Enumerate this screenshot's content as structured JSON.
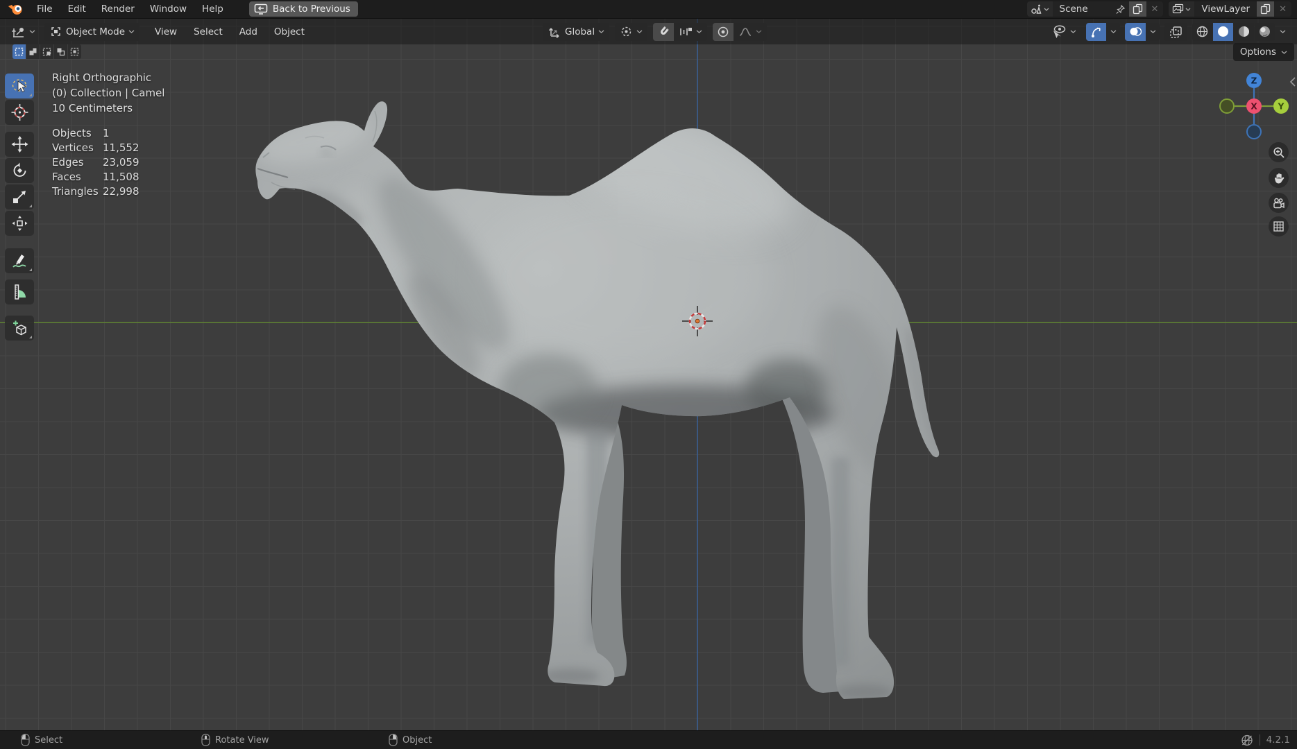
{
  "topbar": {
    "menus": [
      {
        "label": "File"
      },
      {
        "label": "Edit"
      },
      {
        "label": "Render"
      },
      {
        "label": "Window"
      },
      {
        "label": "Help"
      }
    ],
    "back_button": {
      "label": "Back to Previous"
    },
    "scene_selector": {
      "value": "Scene"
    },
    "viewlayer_selector": {
      "value": "ViewLayer"
    }
  },
  "viewport_header": {
    "mode_selector": {
      "value": "Object Mode"
    },
    "menus": [
      {
        "label": "View"
      },
      {
        "label": "Select"
      },
      {
        "label": "Add"
      },
      {
        "label": "Object"
      }
    ],
    "transform_orientation": {
      "value": "Global"
    },
    "options_button": {
      "label": "Options"
    }
  },
  "tool_settings": {
    "select_modes": [
      "set",
      "extend",
      "subtract",
      "invert",
      "intersect"
    ],
    "active_mode": "set"
  },
  "toolbar": {
    "active_tool": "tweak-select",
    "tools": [
      "tweak-select",
      "cursor",
      "move",
      "rotate",
      "scale",
      "transform",
      "annotate",
      "measure",
      "add-cube"
    ]
  },
  "viewport_info": {
    "view": "Right Orthographic",
    "context": "(0) Collection | Camel",
    "grid_scale": "10 Centimeters",
    "stats": [
      {
        "label": "Objects",
        "value": "1"
      },
      {
        "label": "Vertices",
        "value": "11,552"
      },
      {
        "label": "Edges",
        "value": "23,059"
      },
      {
        "label": "Faces",
        "value": "11,508"
      },
      {
        "label": "Triangles",
        "value": "22,998"
      }
    ]
  },
  "nav_gizmo": {
    "axis_x": "X",
    "axis_y": "Y",
    "axis_z": "Z"
  },
  "status_bar": {
    "hints": [
      {
        "button": "left-mouse",
        "label": "Select"
      },
      {
        "button": "middle-mouse",
        "label": "Rotate View"
      },
      {
        "button": "right-mouse",
        "label": "Object"
      }
    ],
    "version": "4.2.1"
  },
  "colors": {
    "accent_blue": "#4772b3",
    "axis_x": "#ee5170",
    "axis_y": "#a6ce3d",
    "axis_z": "#4284d7",
    "viewport_bg": "#3d3d3d"
  }
}
